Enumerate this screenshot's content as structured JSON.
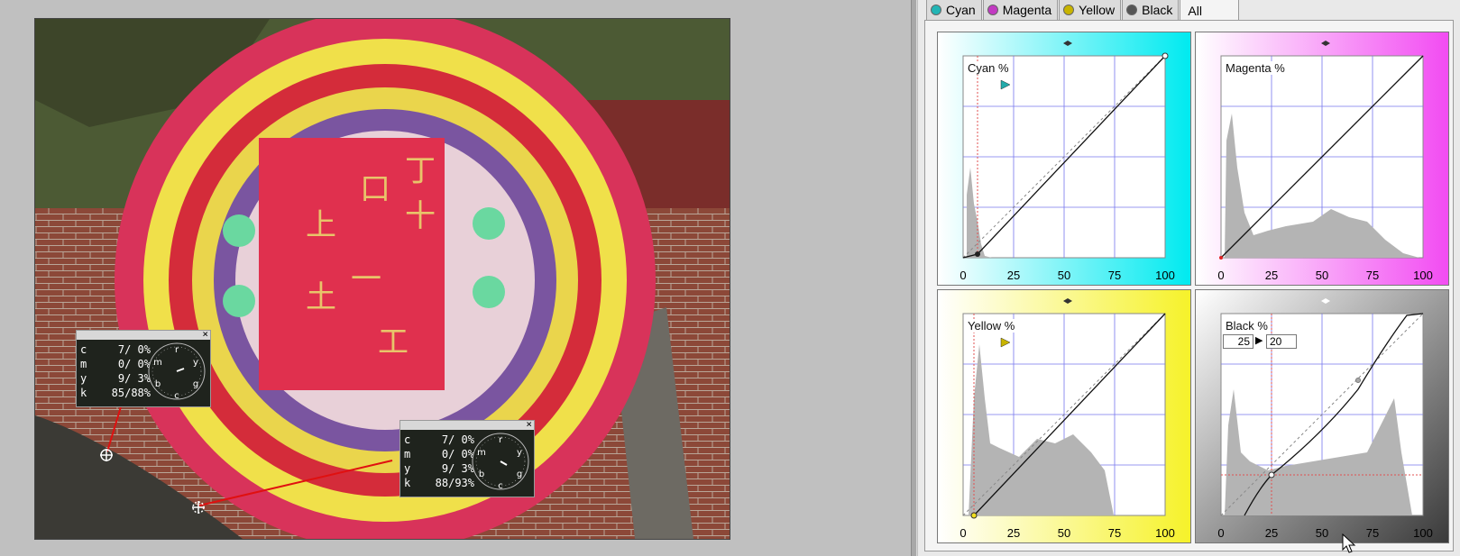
{
  "tabs": [
    {
      "label": "Cyan",
      "color": "#22b5b5"
    },
    {
      "label": "Magenta",
      "color": "#c23ac2"
    },
    {
      "label": "Yellow",
      "color": "#c8b400"
    },
    {
      "label": "Black",
      "color": "#555555"
    },
    {
      "label": "All",
      "active": true
    }
  ],
  "curves": {
    "cyan": {
      "title": "Cyan %",
      "color": "#00eaf0",
      "ticks": [
        "0",
        "25",
        "50",
        "75",
        "100"
      ]
    },
    "magenta": {
      "title": "Magenta %",
      "color": "#f24cf2",
      "ticks": [
        "0",
        "25",
        "50",
        "75",
        "100"
      ]
    },
    "yellow": {
      "title": "Yellow %",
      "color": "#f6f22a",
      "ticks": [
        "0",
        "25",
        "50",
        "75",
        "100"
      ]
    },
    "black": {
      "title": "Black %",
      "color": "#444444",
      "ticks": [
        "0",
        "25",
        "50",
        "75",
        "100"
      ],
      "input_value": "25",
      "output_value": "20"
    }
  },
  "readouts": [
    {
      "rows": [
        {
          "label": "c",
          "value": "7/ 0%"
        },
        {
          "label": "m",
          "value": "0/ 0%"
        },
        {
          "label": "y",
          "value": "9/ 3%"
        },
        {
          "label": "k",
          "value": "85/88%"
        }
      ],
      "dial_letters": [
        "r",
        "y",
        "g",
        "c",
        "b",
        "m"
      ]
    },
    {
      "rows": [
        {
          "label": "c",
          "value": "7/ 0%"
        },
        {
          "label": "m",
          "value": "0/ 0%"
        },
        {
          "label": "y",
          "value": "9/ 3%"
        },
        {
          "label": "k",
          "value": "88/93%"
        }
      ],
      "dial_letters": [
        "r",
        "y",
        "g",
        "c",
        "b",
        "m"
      ]
    }
  ],
  "close_glyph": "×"
}
